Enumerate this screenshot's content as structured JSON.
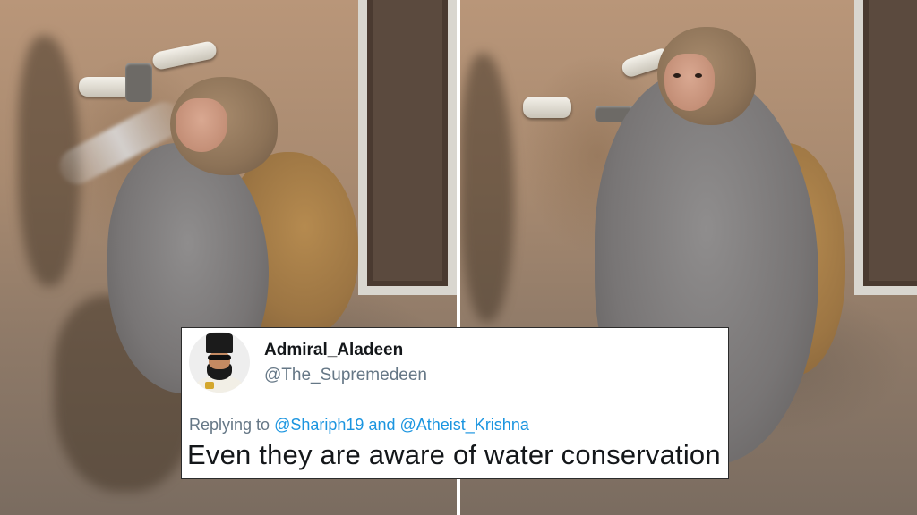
{
  "tweet": {
    "display_name": "Admiral_Aladeen",
    "handle": "@The_Supremedeen",
    "replying_prefix": "Replying to",
    "reply_to": [
      "@Shariph19",
      "@Atheist_Krishna"
    ],
    "reply_joiner": "and",
    "text": "Even they are aware of water conservation"
  },
  "colors": {
    "card_background": "#ffffff",
    "name_text": "#14171a",
    "secondary_text": "#657786",
    "mention_link": "#1b95e0"
  },
  "icons": {
    "avatar": "bearded-man-with-sunglasses-avatar"
  }
}
